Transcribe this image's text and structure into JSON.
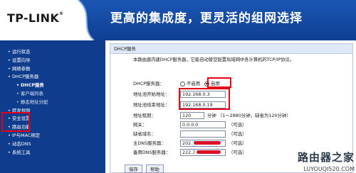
{
  "header": {
    "brand": "TP-LINK",
    "slogan": "更高的集成度，更灵活的组网选择",
    "brand_color": "#0f3c8c"
  },
  "sidebar": {
    "items": [
      {
        "label": "运行状态",
        "level": 1
      },
      {
        "label": "设置向导",
        "level": 1
      },
      {
        "label": "网络参数",
        "level": 1
      },
      {
        "label": "DHCP服务器",
        "level": 1
      },
      {
        "label": "DHCP服务",
        "level": 2,
        "active": true
      },
      {
        "label": "客户端列表",
        "level": 2
      },
      {
        "label": "静态地址分配",
        "level": 2
      },
      {
        "label": "转发规则",
        "level": 1
      },
      {
        "label": "安全设置",
        "level": 1
      },
      {
        "label": "路由功能",
        "level": 1
      },
      {
        "label": "IP与MAC绑定",
        "level": 1
      },
      {
        "label": "动态DNS",
        "level": 1
      },
      {
        "label": "系统工具",
        "level": 1
      }
    ]
  },
  "panel": {
    "title": "DHCP服务",
    "description": "本路由器内建DHCP服务器，它能自动替您配置局域网中各计算机的TCP/IP协议。",
    "dhcp_server": {
      "label": "DHCP服务器：",
      "options": [
        "不启用",
        "启用"
      ],
      "selected": "启用"
    },
    "start_ip": {
      "label": "地址池开始地址：",
      "value": "192.168.0.3"
    },
    "end_ip": {
      "label": "地址池结束地址：",
      "value": "192.168.0.19"
    },
    "lease": {
      "label": "地址租期：",
      "value": "120",
      "hint": "分钟 （1～2880分钟，缺省为120分钟）"
    },
    "gateway": {
      "label": "网关：",
      "value": "0.0.0.0",
      "hint": "（可选）"
    },
    "domain": {
      "label": "缺省域名：",
      "value": "",
      "hint": "（可选）"
    },
    "dns_primary": {
      "label": "主DNS服务器：",
      "value": "202.",
      "hint": "（可选）"
    },
    "dns_secondary": {
      "label": "备用DNS服务器：",
      "value": "222.7",
      "hint": "（可选）"
    },
    "buttons": {
      "save": "保存",
      "help": "帮助"
    }
  },
  "watermark": {
    "text": "路由器之家",
    "url": "LUYOUQI520.COM"
  },
  "colors": {
    "highlight": "#e60012",
    "panel_header": "#dfe8f6"
  }
}
